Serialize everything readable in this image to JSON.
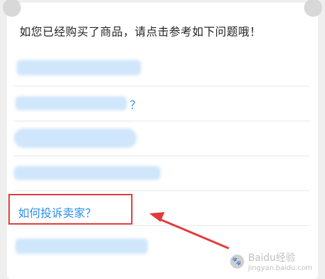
{
  "header": {
    "title": "如您已经购买了商品，请点击参考如下问题哦！"
  },
  "faq": {
    "items": [
      {
        "label": "",
        "blurred": true
      },
      {
        "label": "？",
        "blurred": true
      },
      {
        "label": "",
        "blurred": true
      },
      {
        "label": "",
        "blurred": true
      },
      {
        "label": "如何投诉卖家？",
        "blurred": false
      },
      {
        "label": "",
        "blurred": true
      }
    ]
  },
  "watermark": {
    "brand": "Baidu经验",
    "domain": "jingyan.baidu.com"
  }
}
